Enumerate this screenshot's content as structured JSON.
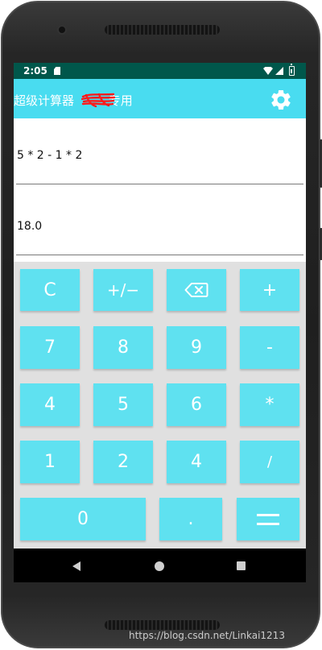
{
  "status_bar": {
    "time": "2:05"
  },
  "app_bar": {
    "title_left": "超级计算器 ",
    "title_right": "专用"
  },
  "display": {
    "expression": "5 * 2 - 1 * 2",
    "result": "18.0"
  },
  "keypad": {
    "clear": "C",
    "sign": "+/−",
    "plus": "+",
    "seven": "7",
    "eight": "8",
    "nine": "9",
    "minus": "-",
    "four_a": "4",
    "five": "5",
    "six": "6",
    "multiply": "*",
    "one": "1",
    "two": "2",
    "four_b": "4",
    "divide": "/",
    "zero": "0",
    "dot": "."
  },
  "icons": {
    "backspace": "backspace-icon",
    "settings": "gear-icon",
    "equals": "equals-icon"
  },
  "colors": {
    "status_bar": "#00574b",
    "app_bar": "#49dcf0",
    "key": "#5fe1f0",
    "keypad_bg": "#e0e0e0",
    "scribble": "#ff1a1a"
  },
  "watermark": "https://blog.csdn.net/Linkai1213"
}
